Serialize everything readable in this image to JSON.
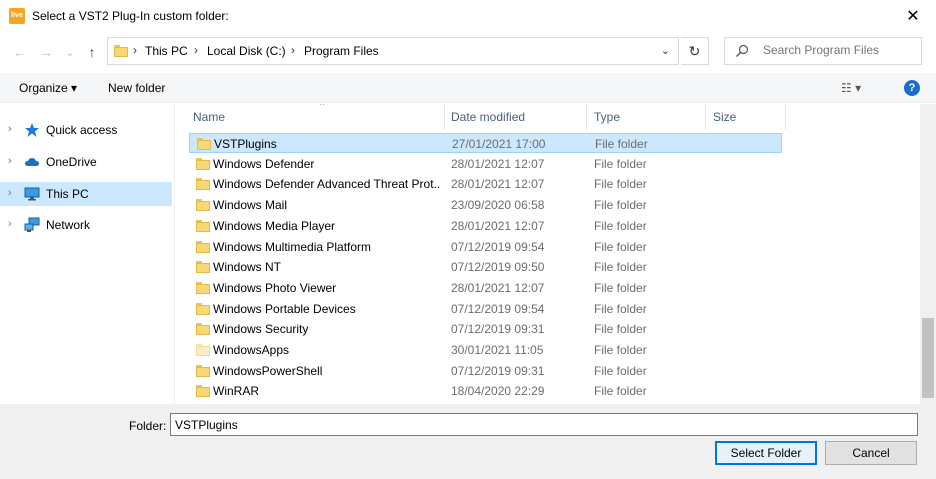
{
  "titlebar": {
    "app_icon_text": "live",
    "title": "Select a VST2 Plug-In custom folder:",
    "close_glyph": "✕"
  },
  "nav": {
    "back_glyph": "←",
    "forward_glyph": "→",
    "recent_glyph": "⌄",
    "up_glyph": "↑",
    "breadcrumbs": [
      "This PC",
      "Local Disk (C:)",
      "Program Files"
    ],
    "separator": "›",
    "dropdown_glyph": "⌄",
    "refresh_glyph": "↻",
    "search_placeholder": "Search Program Files"
  },
  "toolbar": {
    "organize": "Organize ▾",
    "new_folder": "New folder",
    "view": "☷ ▾",
    "help": "?"
  },
  "sidebar": {
    "items": [
      {
        "label": "Quick access",
        "icon": "star-icon",
        "selected": false
      },
      {
        "label": "OneDrive",
        "icon": "cloud-icon",
        "selected": false
      },
      {
        "label": "This PC",
        "icon": "monitor-icon",
        "selected": true
      },
      {
        "label": "Network",
        "icon": "network-icon",
        "selected": false
      }
    ],
    "chevron": "›"
  },
  "columns": {
    "name": "Name",
    "date": "Date modified",
    "type": "Type",
    "size": "Size",
    "sort_glyph": "^"
  },
  "files": [
    {
      "name": "VSTPlugins",
      "date": "27/01/2021 17:00",
      "type": "File folder",
      "selected": true,
      "faded": false
    },
    {
      "name": "Windows Defender",
      "date": "28/01/2021 12:07",
      "type": "File folder",
      "selected": false,
      "faded": false
    },
    {
      "name": "Windows Defender Advanced Threat Prot...",
      "date": "28/01/2021 12:07",
      "type": "File folder",
      "selected": false,
      "faded": false
    },
    {
      "name": "Windows Mail",
      "date": "23/09/2020 06:58",
      "type": "File folder",
      "selected": false,
      "faded": false
    },
    {
      "name": "Windows Media Player",
      "date": "28/01/2021 12:07",
      "type": "File folder",
      "selected": false,
      "faded": false
    },
    {
      "name": "Windows Multimedia Platform",
      "date": "07/12/2019 09:54",
      "type": "File folder",
      "selected": false,
      "faded": false
    },
    {
      "name": "Windows NT",
      "date": "07/12/2019 09:50",
      "type": "File folder",
      "selected": false,
      "faded": false
    },
    {
      "name": "Windows Photo Viewer",
      "date": "28/01/2021 12:07",
      "type": "File folder",
      "selected": false,
      "faded": false
    },
    {
      "name": "Windows Portable Devices",
      "date": "07/12/2019 09:54",
      "type": "File folder",
      "selected": false,
      "faded": false
    },
    {
      "name": "Windows Security",
      "date": "07/12/2019 09:31",
      "type": "File folder",
      "selected": false,
      "faded": false
    },
    {
      "name": "WindowsApps",
      "date": "30/01/2021 11:05",
      "type": "File folder",
      "selected": false,
      "faded": true
    },
    {
      "name": "WindowsPowerShell",
      "date": "07/12/2019 09:31",
      "type": "File folder",
      "selected": false,
      "faded": false
    },
    {
      "name": "WinRAR",
      "date": "18/04/2020 22:29",
      "type": "File folder",
      "selected": false,
      "faded": false
    }
  ],
  "footer": {
    "folder_label": "Folder:",
    "folder_value": "VSTPlugins",
    "select_button": "Select Folder",
    "cancel_button": "Cancel"
  },
  "colors": {
    "selection": "#cce8ff",
    "accent": "#0078d7",
    "folder": "#f8d775"
  }
}
